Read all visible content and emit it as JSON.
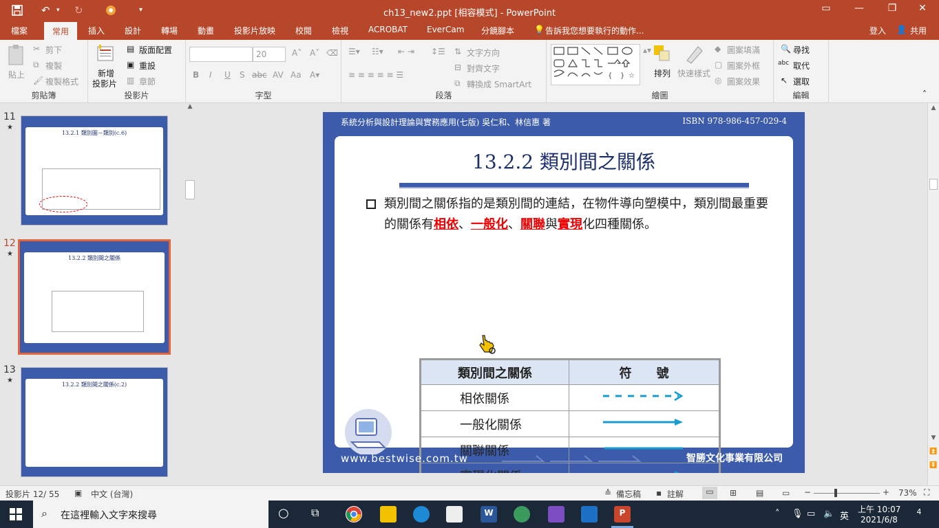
{
  "titlebar": {
    "title": "ch13_new2.ppt [相容模式] - PowerPoint",
    "icons": [
      "save-icon",
      "undo-icon",
      "redo-icon",
      "presenter-icon",
      "customize-icon"
    ],
    "window_buttons": [
      "ribbon-options-icon",
      "minimize-icon",
      "restore-icon",
      "close-icon"
    ]
  },
  "tabs": {
    "file": "檔案",
    "home": "常用",
    "insert": "插入",
    "design": "設計",
    "transitions": "轉場",
    "animations": "動畫",
    "slideshow": "投影片放映",
    "review": "校閱",
    "view": "檢視",
    "acrobat": "ACROBAT",
    "evercam": "EverCam",
    "storyboard": "分鏡腳本",
    "tellme": "告訴我您想要執行的動作...",
    "signin": "登入",
    "share": "共用"
  },
  "ribbon": {
    "clipboard": {
      "label": "剪貼簿",
      "paste": "貼上",
      "cut": "剪下",
      "copy": "複製",
      "format_painter": "複製格式"
    },
    "slides": {
      "label": "投影片",
      "new_slide": "新增",
      "new_slide2": "投影片",
      "layout": "版面配置",
      "reset": "重設",
      "section": "章節"
    },
    "font": {
      "label": "字型",
      "size": "20",
      "bold": "B",
      "italic": "I",
      "underline": "U",
      "shadow": "S",
      "strike": "abc",
      "spacing": "AV",
      "case": "Aa"
    },
    "paragraph": {
      "label": "段落",
      "text_direction": "文字方向",
      "align_text": "對齊文字",
      "smartart": "轉換成 SmartArt"
    },
    "drawing": {
      "label": "繪圖",
      "arrange": "排列",
      "quick_styles": "快速樣式",
      "fill": "圖案填滿",
      "outline": "圖案外框",
      "effects": "圖案效果"
    },
    "editing": {
      "label": "編輯",
      "find": "尋找",
      "replace": "取代",
      "select": "選取"
    }
  },
  "thumbnails": [
    {
      "num": "11",
      "star": "★",
      "title": "13.2.1 類別圖－類別(c.6)"
    },
    {
      "num": "12",
      "star": "★",
      "title": "13.2.2 類別間之關係"
    },
    {
      "num": "13",
      "star": "★",
      "title": "13.2.2 類別間之關係(c.2)"
    }
  ],
  "slide": {
    "header": "系統分析與設計理論與實務應用(七版)  吳仁和、林信惠 著",
    "isbn": "ISBN 978-986-457-029-4",
    "title": "13.2.2 類別間之關係",
    "bullet_pre": "類別間之關係指的是類別間的連結，在物件導向塑模中，類別間最重要的關係有",
    "kw1": "相依",
    "sep1": "、",
    "kw2": "一般化",
    "sep2": "、",
    "kw3": "關聯",
    "sep3": "與",
    "kw4": "實現",
    "bullet_post": "化四種關係。",
    "table": {
      "headers": [
        "類別間之關係",
        "符　　號"
      ],
      "rows": [
        {
          "name": "相依關係",
          "symbol": "dashed-open-arrow"
        },
        {
          "name": "一般化關係",
          "symbol": "solid-triangle-arrow"
        },
        {
          "name": "關聯關係",
          "symbol": "solid-line"
        },
        {
          "name": "實現化關係",
          "symbol": "dashed-triangle-arrow"
        }
      ]
    },
    "footer_url": "www.bestwise.com.tw",
    "footer_company": "智勝文化事業有限公司"
  },
  "statusbar": {
    "slide_pos": "投影片 12/ 55",
    "language": "中文 (台灣)",
    "notes": "備忘稿",
    "comments": "註解",
    "zoom": "73%"
  },
  "taskbar": {
    "search_placeholder": "在這裡輸入文字來搜尋",
    "time": "上午 10:07",
    "date": "2021/6/8",
    "ime": "英",
    "notifications": "4"
  },
  "colors": {
    "accent": "#b7472a",
    "slide_blue": "#3c5cab",
    "title_navy": "#1d2f6b",
    "connector": "#1a9bd0",
    "keyword_red": "#ee0000"
  }
}
